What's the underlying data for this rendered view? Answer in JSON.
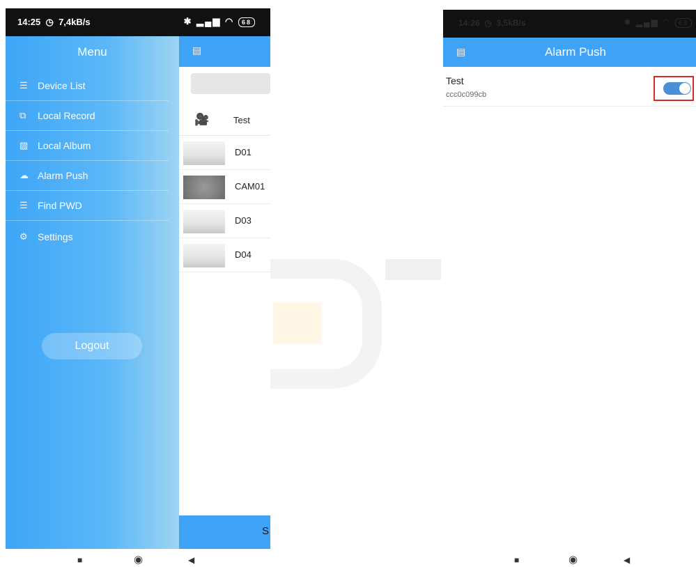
{
  "left": {
    "status": {
      "time": "14:25",
      "speed": "7,4kB/s",
      "battery": "68"
    },
    "drawer": {
      "title": "Menu",
      "items": [
        {
          "label": "Device List",
          "icon": "list-icon"
        },
        {
          "label": "Local Record",
          "icon": "video-record-icon"
        },
        {
          "label": "Local Album",
          "icon": "photo-album-icon"
        },
        {
          "label": "Alarm Push",
          "icon": "cloud-push-icon"
        },
        {
          "label": "Find PWD",
          "icon": "key-list-icon"
        },
        {
          "label": "Settings",
          "icon": "gear-icon"
        }
      ],
      "logout": "Logout"
    },
    "devices": {
      "group": "Test",
      "cameras": [
        "D01",
        "CAM01",
        "D03",
        "D04"
      ],
      "bottom_label": "S"
    }
  },
  "right": {
    "status": {
      "time": "14:26",
      "speed": "3,5kB/s",
      "battery": "68"
    },
    "title": "Alarm Push",
    "device": {
      "name": "Test",
      "id": "ccc0c099cb",
      "alarm_enabled": true
    }
  },
  "colors": {
    "accent": "#3fa4f8",
    "highlight": "#d22a2a",
    "toggle": "#4a90d8"
  }
}
